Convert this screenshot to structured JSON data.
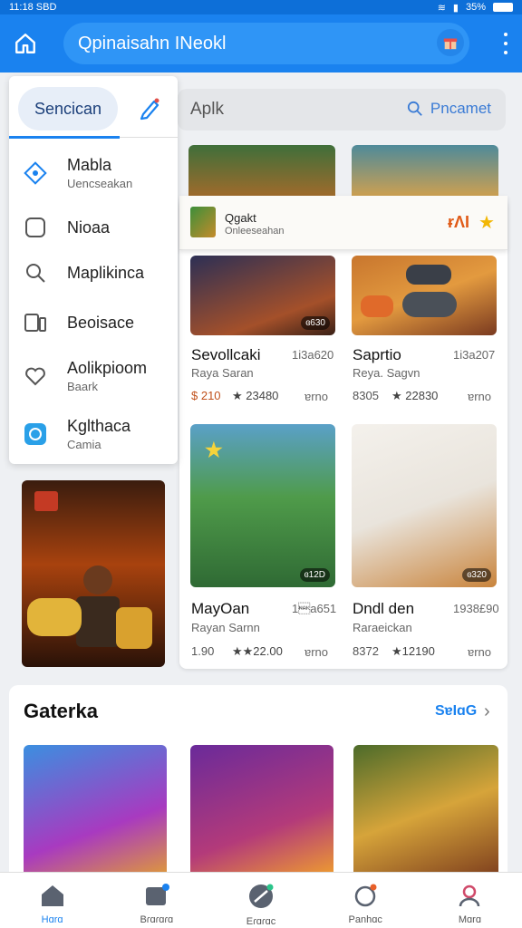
{
  "status": {
    "time": "11:18 SBD",
    "battery": "35%"
  },
  "appbar": {
    "search_text": "Qpinaisahn INeokl"
  },
  "search2": {
    "placeholder": "Aplk",
    "action": "Pncamet"
  },
  "drawer": {
    "tab": "Sencican",
    "items": [
      {
        "label": "Mabla",
        "sub": "Uencseakan",
        "icon": "diamond-icon"
      },
      {
        "label": "Nioaa",
        "sub": "",
        "icon": "square-icon"
      },
      {
        "label": "Maplikinca",
        "sub": "",
        "icon": "search-gear-icon"
      },
      {
        "label": "Beoisace",
        "sub": "",
        "icon": "device-icon"
      },
      {
        "label": "Aolikpioom",
        "sub": "Baark",
        "icon": "heart-icon"
      },
      {
        "label": "Kglthaca",
        "sub": "Camia",
        "icon": "chat-icon"
      }
    ]
  },
  "popup": {
    "title": "Qgakt",
    "sub": "Onleeseahan",
    "count": "ɍɅI"
  },
  "games": [
    {
      "title": "Sevollcaki",
      "num": "1i3a620",
      "sub": "Raya Saran",
      "meta": "$ 210",
      "rating": "★ 23480",
      "price": "ɐrno"
    },
    {
      "title": "Saprtio",
      "num": "1i3a207",
      "sub": "Reya. Sagvn",
      "meta": "8305",
      "rating": "★ 22830",
      "price": "ɐrno"
    },
    {
      "title": "MayOan",
      "num": "1\u0015a651",
      "sub": "Rayan Sarnn",
      "meta": "1.90",
      "rating": "★★22.00",
      "price": "ɐrno"
    },
    {
      "title": "Dndl den",
      "num": "1938£90",
      "sub": "Raraeickan",
      "meta": "8372",
      "rating": "★12190",
      "price": "ɐrno"
    }
  ],
  "badges": [
    "ɞ630",
    "ɞ12D",
    "ɞ320"
  ],
  "section": {
    "title": "Gaterka",
    "link": "SɐIɑG"
  },
  "nav": [
    {
      "label": "Hɑrɑ",
      "icon": "home-icon",
      "active": true
    },
    {
      "label": "Bɾɑɾɑɾɑ",
      "icon": "download-icon",
      "active": false
    },
    {
      "label": "Eɾɑɾɑc",
      "icon": "games-icon",
      "active": false
    },
    {
      "label": "Panhɑc",
      "icon": "chat-icon",
      "active": false
    },
    {
      "label": "Mɑrɑ",
      "icon": "profile-icon",
      "active": false
    }
  ],
  "colors": {
    "primary": "#1a82ef",
    "accent": "#e05a17",
    "star": "#f2b705"
  }
}
